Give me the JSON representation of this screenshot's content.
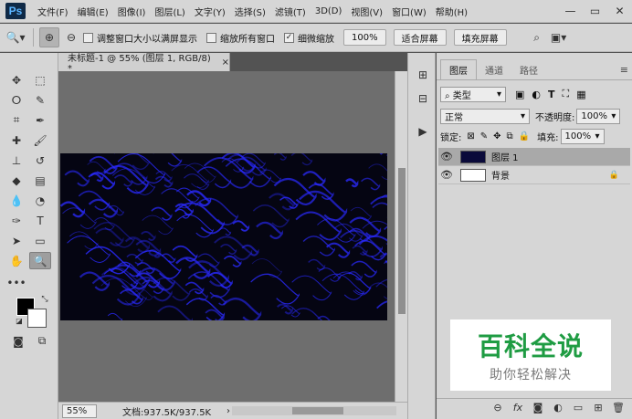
{
  "app": {
    "logo": "Ps"
  },
  "menubar": {
    "items": [
      "文件(F)",
      "编辑(E)",
      "图像(I)",
      "图层(L)",
      "文字(Y)",
      "选择(S)",
      "滤镜(T)",
      "3D(D)",
      "视图(V)",
      "窗口(W)",
      "帮助(H)"
    ],
    "window_controls": [
      "—",
      "▭",
      "✕"
    ]
  },
  "options": {
    "resize_windows_label": "调整窗口大小以满屏显示",
    "resize_windows_checked": false,
    "zoom_all_windows_label": "缩放所有窗口",
    "zoom_all_windows_checked": false,
    "scrubby_zoom_label": "细微缩放",
    "scrubby_zoom_checked": true,
    "zoom_100_label": "100%",
    "fit_screen_label": "适合屏幕",
    "fill_screen_label": "填充屏幕"
  },
  "document": {
    "tab_title": "未标题-1 @ 55% (图层 1, RGB/8) *",
    "tab_close": "×"
  },
  "status": {
    "zoom": "55%",
    "doc_info": "文档:937.5K/937.5K",
    "arrow": "›"
  },
  "layers_panel": {
    "tabs": [
      "图层",
      "通道",
      "路径"
    ],
    "filter_kind": "类型",
    "blend_mode": "正常",
    "opacity_label": "不透明度:",
    "opacity_value": "100%",
    "lock_label": "锁定:",
    "fill_label": "填充:",
    "fill_value": "100%",
    "layers": [
      {
        "name": "图层 1",
        "selected": true,
        "locked": false,
        "thumb_color": "#0a0a3a"
      },
      {
        "name": "背景",
        "selected": false,
        "locked": true,
        "thumb_color": "#ffffff"
      }
    ],
    "bottom_icons": [
      "link-icon",
      "fx-icon",
      "mask-icon",
      "adjustment-icon",
      "group-icon",
      "new-layer-icon",
      "trash-icon"
    ]
  },
  "colors": {
    "foreground": "#000000",
    "background": "#ffffff",
    "canvas_tint": "#2a2aff"
  },
  "watermark": {
    "title": "百科全说",
    "subtitle": "助你轻松解决"
  }
}
